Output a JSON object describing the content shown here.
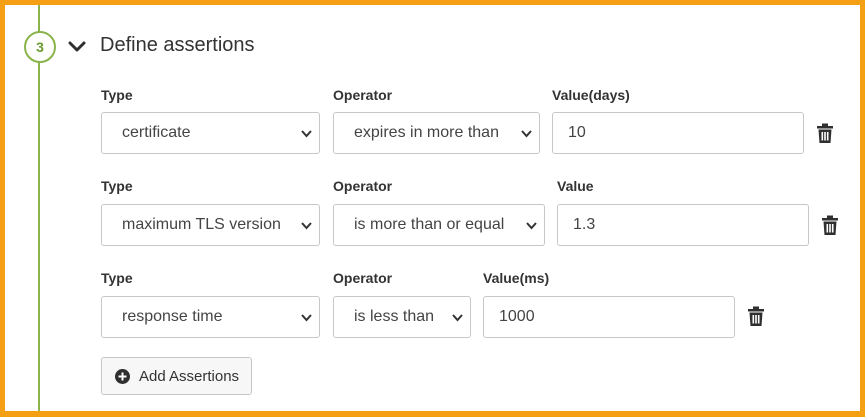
{
  "step": {
    "number": "3",
    "title": "Define assertions"
  },
  "assertions": [
    {
      "type_label": "Type",
      "type_value": "certificate",
      "operator_label": "Operator",
      "operator_value": "expires in more than",
      "value_label": "Value(days)",
      "value": "10"
    },
    {
      "type_label": "Type",
      "type_value": "maximum TLS version",
      "operator_label": "Operator",
      "operator_value": "is more than or equal",
      "value_label": "Value",
      "value": "1.3"
    },
    {
      "type_label": "Type",
      "type_value": "response time",
      "operator_label": "Operator",
      "operator_value": "is less than",
      "value_label": "Value(ms)",
      "value": "1000"
    }
  ],
  "add_button": {
    "label": "Add Assertions"
  },
  "colors": {
    "frame": "#f5a014",
    "timeline": "#8ab44b",
    "text": "#333333"
  }
}
